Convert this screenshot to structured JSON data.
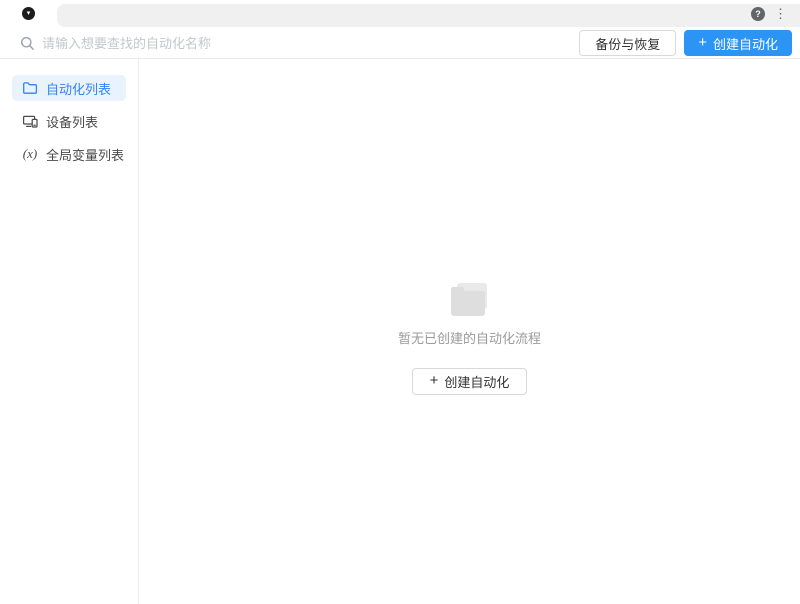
{
  "titlebar": {
    "logo_glyph": "▾",
    "help_glyph": "?",
    "menu_glyph": "⋮"
  },
  "toolbar": {
    "search": {
      "placeholder": "请输入想要查找的自动化名称"
    },
    "backup_label": "备份与恢复",
    "plus": "+",
    "create_label": "创建自动化"
  },
  "sidebar": {
    "items": [
      {
        "label": "自动化列表",
        "active": true,
        "icon": "folder-icon"
      },
      {
        "label": "设备列表",
        "active": false,
        "icon": "devices-icon"
      },
      {
        "label": "全局变量列表",
        "active": false,
        "icon": "variable-icon",
        "icon_text": "(x)"
      }
    ]
  },
  "main": {
    "empty_state": {
      "message": "暂无已创建的自动化流程",
      "plus": "+",
      "create_label": "创建自动化"
    }
  },
  "colors": {
    "accent": "#2b94f5",
    "accent_text": "#3283f7",
    "active_item_bg": "#e9f3fe",
    "titlebar_bg": "#f0f0f1",
    "placeholder": "#c3c7cc",
    "text_primary": "#4a4a4a",
    "muted_text": "#9b9b9b"
  }
}
